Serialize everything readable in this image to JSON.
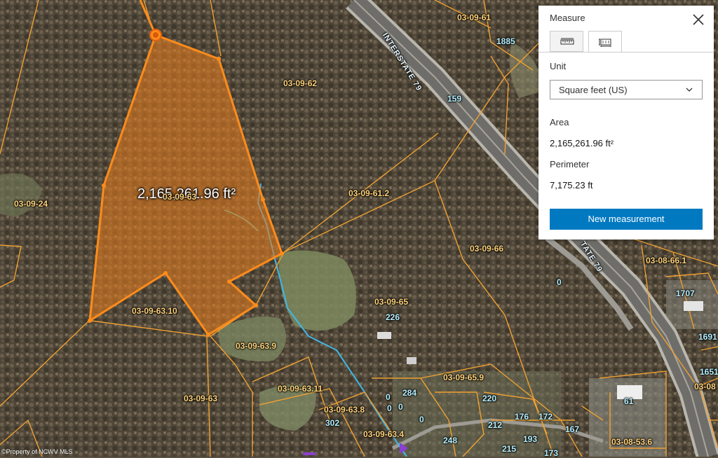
{
  "map": {
    "measure_overlay_label": "2,165,261.96 ft²",
    "copyright": "©Property of NCWV MLS",
    "road_label": "INTERSTATE 79",
    "road_label_2": "TATE 79",
    "parcel_labels": [
      "03-09-61",
      "03-09-62",
      "03-09-63",
      "03-09-24",
      "03-09-61.2",
      "03-09-66",
      "03-09-63.10",
      "03-09-63.9",
      "03-09-65",
      "03-09-63.11",
      "03-09-65.9",
      "03-09-63.8",
      "03-09-63.4",
      "03-09-63",
      "03-08-66.1",
      "03-08-53.6",
      "03-08"
    ],
    "address_labels": [
      "1885",
      "159",
      "0",
      "1707",
      "1691",
      "1651",
      "226",
      "284",
      "0",
      "0",
      "0",
      "0",
      "220",
      "302",
      "176",
      "172",
      "212",
      "167",
      "61",
      "248",
      "215",
      "193",
      "173"
    ]
  },
  "panel": {
    "title": "Measure",
    "close_icon": "close-icon",
    "tabs": [
      {
        "name": "distance-tab",
        "icon": "ruler-icon",
        "active": false
      },
      {
        "name": "area-tab",
        "icon": "area-measure-icon",
        "active": true
      }
    ],
    "unit_label": "Unit",
    "unit_value": "Square feet (US)",
    "area_label": "Area",
    "area_value": "2,165,261.96 ft²",
    "perimeter_label": "Perimeter",
    "perimeter_value": "7,175.23 ft",
    "new_button": "New measurement"
  },
  "colors": {
    "measure_fill": "#e07a1f",
    "parcel_line": "#f0a030",
    "primary_button": "#0079c1",
    "stream": "#3fb8e8"
  }
}
